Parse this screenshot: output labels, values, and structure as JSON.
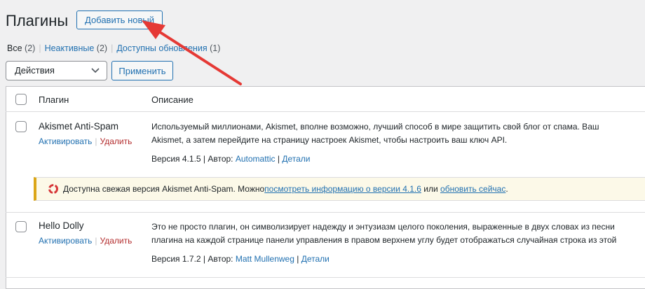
{
  "header": {
    "title": "Плагины",
    "add_new": "Добавить новый"
  },
  "filters": [
    {
      "label": "Все",
      "count": "(2)"
    },
    {
      "label": "Неактивные",
      "count": "(2)"
    },
    {
      "label": "Доступны обновления",
      "count": "(1)"
    }
  ],
  "bulk": {
    "select_value": "Действия",
    "apply": "Применить"
  },
  "table": {
    "col_plugin": "Плагин",
    "col_desc": "Описание"
  },
  "plugins": [
    {
      "name": "Akismet Anti-Spam",
      "activate": "Активировать",
      "delete": "Удалить",
      "desc1": "Используемый миллионами, Akismet, вполне возможно, лучший способ в мире защитить свой блог от спама. Ваш",
      "desc2": "Akismet, а затем перейдите на страницу настроек Akismet, чтобы настроить ваш ключ API.",
      "version": "Версия 4.1.5 | Автор: ",
      "author": "Automattic",
      "details": "Детали"
    },
    {
      "name": "Hello Dolly",
      "activate": "Активировать",
      "delete": "Удалить",
      "desc1": "Это не просто плагин, он символизирует надежду и энтузиазм целого поколения, выраженные в двух словах из песни",
      "desc2": "плагина на каждой странице панели управления в правом верхнем углу будет отображаться случайная строка из этой",
      "version": "Версия 1.7.2 | Автор: ",
      "author": "Matt Mullenweg",
      "details": "Детали"
    }
  ],
  "notice": {
    "text": "Доступна свежая версия Akismet Anti-Spam. Можно ",
    "link1": "посмотреть информацию о версии 4.1.6",
    "mid": " или ",
    "link2": "обновить сейчас",
    "end": "."
  },
  "colors": {
    "accent": "#2271b1",
    "delete": "#b32d2e",
    "notice_border": "#dba617",
    "arrow": "#e53935"
  }
}
